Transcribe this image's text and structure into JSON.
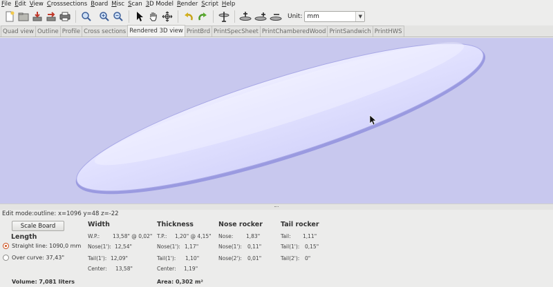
{
  "menu": [
    "File",
    "Edit",
    "View",
    "Crosssections",
    "Board",
    "Misc",
    "Scan",
    "3D Model",
    "Render",
    "Script",
    "Help"
  ],
  "toolbar": {
    "unit_label": "Unit:",
    "unit_value": "mm"
  },
  "tabs": [
    "Quad view",
    "Outline",
    "Profile",
    "Cross sections",
    "Rendered 3D view",
    "PrintBrd",
    "PrintSpecSheet",
    "PrintChamberedWood",
    "PrintSandwich",
    "PrintHWS"
  ],
  "active_tab": "Rendered 3D view",
  "status": "Edit mode:outline: x=1096 y=48 z=-22",
  "panel": {
    "scale_button": "Scale Board",
    "length": {
      "heading": "Length",
      "straight_line": "Straight line: 1090,0 mm",
      "over_curve": "Over curve: 37,43\""
    },
    "width": {
      "heading": "Width",
      "rows": [
        {
          "label": "W.P.:",
          "value": "13,58\" @ 0,02\""
        },
        {
          "label": "Nose(1'):",
          "value": "12,54\""
        },
        {
          "label": "Tail(1'):",
          "value": "12,09\""
        },
        {
          "label": "Center:",
          "value": "13,58\""
        }
      ]
    },
    "thickness": {
      "heading": "Thickness",
      "rows": [
        {
          "label": "T.P.:",
          "value": "1,20\" @ 4,15\""
        },
        {
          "label": "Nose(1'):",
          "value": "1,17\""
        },
        {
          "label": "Tail(1'):",
          "value": "1,10\""
        },
        {
          "label": "Center:",
          "value": "1,19\""
        }
      ]
    },
    "nose_rocker": {
      "heading": "Nose rocker",
      "rows": [
        {
          "label": "Nose:",
          "value": "1,83\""
        },
        {
          "label": "Nose(1'):",
          "value": "0,11\""
        },
        {
          "label": "Nose(2'):",
          "value": "0,01\""
        }
      ]
    },
    "tail_rocker": {
      "heading": "Tail rocker",
      "rows": [
        {
          "label": "Tail:",
          "value": "1,11\""
        },
        {
          "label": "Tail(1'):",
          "value": "0,15\""
        },
        {
          "label": "Tail(2'):",
          "value": "0\""
        }
      ]
    },
    "volume": "Volume: 7,081 liters",
    "area": "Area: 0,302 m²"
  },
  "colors": {
    "viewport_bg": "#c8c8ee",
    "board_fill": "#d9d9ff",
    "board_edge": "#8f8fd8",
    "radio_accent": "#d4541c"
  }
}
